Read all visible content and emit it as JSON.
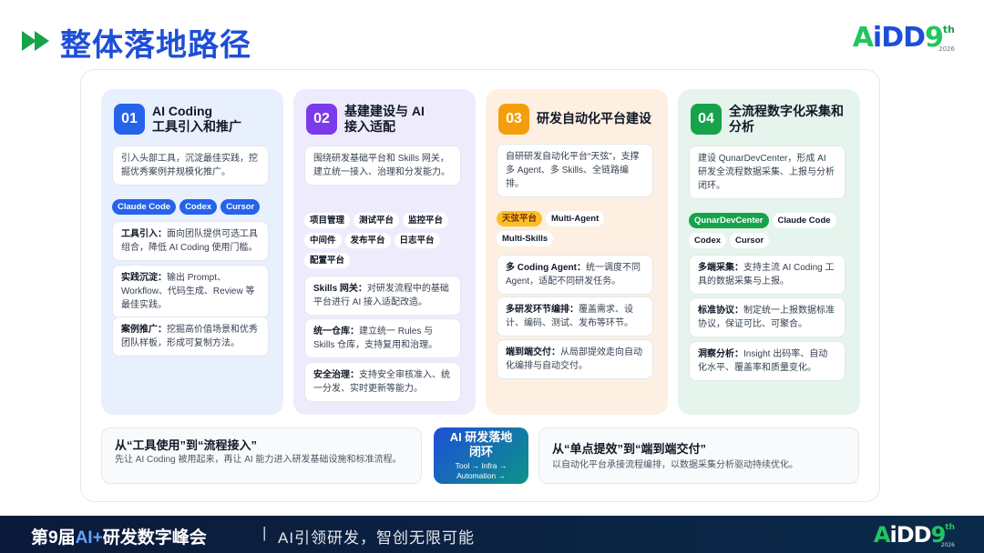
{
  "header": {
    "title": "整体落地路径",
    "logo": {
      "a": "A",
      "i": "i",
      "dd": "DD",
      "nine": "9",
      "th": "th",
      "year": "2026"
    }
  },
  "columns": [
    {
      "num": "01",
      "title": "AI Coding\n工具引入和推广",
      "desc": "引入头部工具，沉淀最佳实践，挖掘优秀案例并规模化推广。",
      "tags": [
        "Claude Code",
        "Codex",
        "Cursor"
      ],
      "items": [
        {
          "label": "工具引入：",
          "text": "面向团队提供可选工具组合，降低 AI Coding 使用门槛。"
        },
        {
          "label": "实践沉淀：",
          "text": "输出 Prompt、Workflow、代码生成、Review 等最佳实践。"
        },
        {
          "label": "案例推广：",
          "text": "挖掘高价值场景和优秀团队样板，形成可复制方法。"
        }
      ]
    },
    {
      "num": "02",
      "title": "基建建设与 AI\n接入适配",
      "desc": "围绕研发基础平台和 Skills 网关，建立统一接入、治理和分发能力。",
      "tags": [
        "项目管理",
        "测试平台",
        "监控平台",
        "中间件",
        "发布平台",
        "日志平台",
        "配置平台"
      ],
      "items": [
        {
          "label": "Skills 网关：",
          "text": "对研发流程中的基础平台进行 AI 接入适配改造。"
        },
        {
          "label": "统一仓库：",
          "text": "建立统一 Rules 与 Skills 仓库，支持复用和治理。"
        },
        {
          "label": "安全治理：",
          "text": "支持安全审核准入、统一分发、实时更新等能力。"
        }
      ]
    },
    {
      "num": "03",
      "title": "研发自动化平台建设",
      "desc": "自研研发自动化平台“天弦”，支撑多 Agent、多 Skills、全链路编排。",
      "tags": [
        "天弦平台",
        "Multi-Agent",
        "Multi-Skills"
      ],
      "items": [
        {
          "label": "多 Coding Agent：",
          "text": "统一调度不同 Agent，适配不同研发任务。"
        },
        {
          "label": "多研发环节编排：",
          "text": "覆盖需求、设计、编码、测试、发布等环节。"
        },
        {
          "label": "端到端交付：",
          "text": "从局部提效走向自动化编排与自动交付。"
        }
      ]
    },
    {
      "num": "04",
      "title": "全流程数字化采集和\n分析",
      "desc": "建设 QunarDevCenter，形成 AI 研发全流程数据采集、上报与分析闭环。",
      "tags": [
        "QunarDevCenter",
        "Claude Code",
        "Codex",
        "Cursor"
      ],
      "items": [
        {
          "label": "多端采集：",
          "text": "支持主流 AI Coding 工具的数据采集与上报。"
        },
        {
          "label": "标准协议：",
          "text": "制定统一上报数据标准协议，保证可比、可聚合。"
        },
        {
          "label": "洞察分析：",
          "text": "Insight 出码率、自动化水平、覆盖率和质量变化。"
        }
      ]
    }
  ],
  "bottom": {
    "left": {
      "title": "从“工具使用”到“流程接入”",
      "desc": "先让 AI Coding 被用起来，再让 AI 能力进入研发基础设施和标准流程。"
    },
    "center": {
      "title": "AI 研发落地\n闭环",
      "sub1": "Tool → Infra →",
      "sub2": "Automation →"
    },
    "right": {
      "title": "从“单点提效”到“端到端交付”",
      "desc": "以自动化平台承接流程编排，以数据采集分析驱动持续优化。"
    }
  },
  "footer": {
    "pre": "第9届",
    "hl": "AI+",
    "post": "研发数字峰会",
    "sep": "|",
    "slogan": "AI引领研发，智创无限可能"
  },
  "colors": {
    "blue": "#2563eb",
    "purple": "#7c3aed",
    "orange": "#f59e0b",
    "green": "#16a34a"
  }
}
